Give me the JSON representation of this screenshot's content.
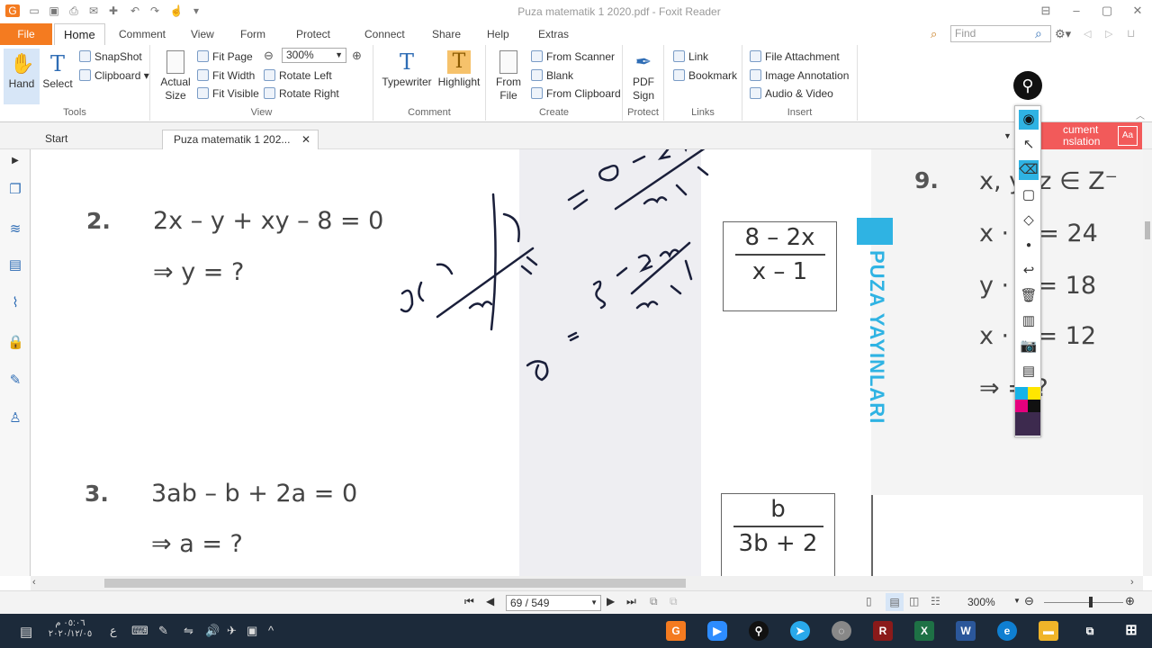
{
  "titlebar": {
    "title": "Puza matematik 1 2020.pdf - Foxit Reader"
  },
  "menu": {
    "file": "File",
    "tabs": [
      "Home",
      "Comment",
      "View",
      "Form",
      "Protect",
      "Connect",
      "Share",
      "Help",
      "Extras"
    ],
    "find_placeholder": "Find"
  },
  "ribbon": {
    "tools": {
      "label": "Tools",
      "hand": "Hand",
      "select": "Select",
      "snapshot": "SnapShot",
      "clipboard": "Clipboard"
    },
    "view": {
      "label": "View",
      "actual_size_1": "Actual",
      "actual_size_2": "Size",
      "fit_page": "Fit Page",
      "fit_width": "Fit Width",
      "fit_visible": "Fit Visible",
      "zoom": "300%",
      "rotate_left": "Rotate Left",
      "rotate_right": "Rotate Right"
    },
    "comment": {
      "label": "Comment",
      "typewriter": "Typewriter",
      "highlight": "Highlight"
    },
    "create": {
      "label": "Create",
      "from_file_1": "From",
      "from_file_2": "File",
      "from_scanner": "From Scanner",
      "blank": "Blank",
      "from_clipboard": "From Clipboard"
    },
    "protect": {
      "label": "Protect",
      "pdf_sign_1": "PDF",
      "pdf_sign_2": "Sign"
    },
    "links": {
      "label": "Links",
      "link": "Link",
      "bookmark": "Bookmark"
    },
    "insert": {
      "label": "Insert",
      "file_attachment": "File Attachment",
      "image_annotation": "Image Annotation",
      "audio_video": "Audio & Video"
    }
  },
  "doc_tabs": {
    "start": "Start",
    "current": "Puza matematik 1 202..."
  },
  "translation_banner": "cument\nnslation",
  "page": {
    "q2": {
      "num": "2.",
      "eq": "2x – y + xy – 8 = 0",
      "ask": "⇒ y = ?"
    },
    "q3": {
      "num": "3.",
      "eq": "3ab – b + 2a = 0",
      "ask": "⇒ a = ?"
    },
    "ans2": {
      "num": "8 – 2x",
      "den": "x – 1"
    },
    "ans3": {
      "num": "b",
      "den": "3b + 2"
    },
    "publisher": "PUZA YAYINLARI",
    "q9": {
      "num": "9.",
      "l1": "x, y, z ∈ Z⁻",
      "l2": "x · y = 24",
      "l3": "y · z = 18",
      "l4": "x · z = 12",
      "l5": "⇒ = ?"
    }
  },
  "status": {
    "page": "69 / 549",
    "zoom": "300%"
  },
  "taskbar": {
    "time": "٠٥:٠٦ م",
    "date": "٢٠٢٠/١٢/٠٥",
    "lang": "ع"
  },
  "colors": {
    "accent": "#f47b20",
    "taskbar": "#1c2a3a",
    "publisher_blue": "#2fb3e3"
  }
}
